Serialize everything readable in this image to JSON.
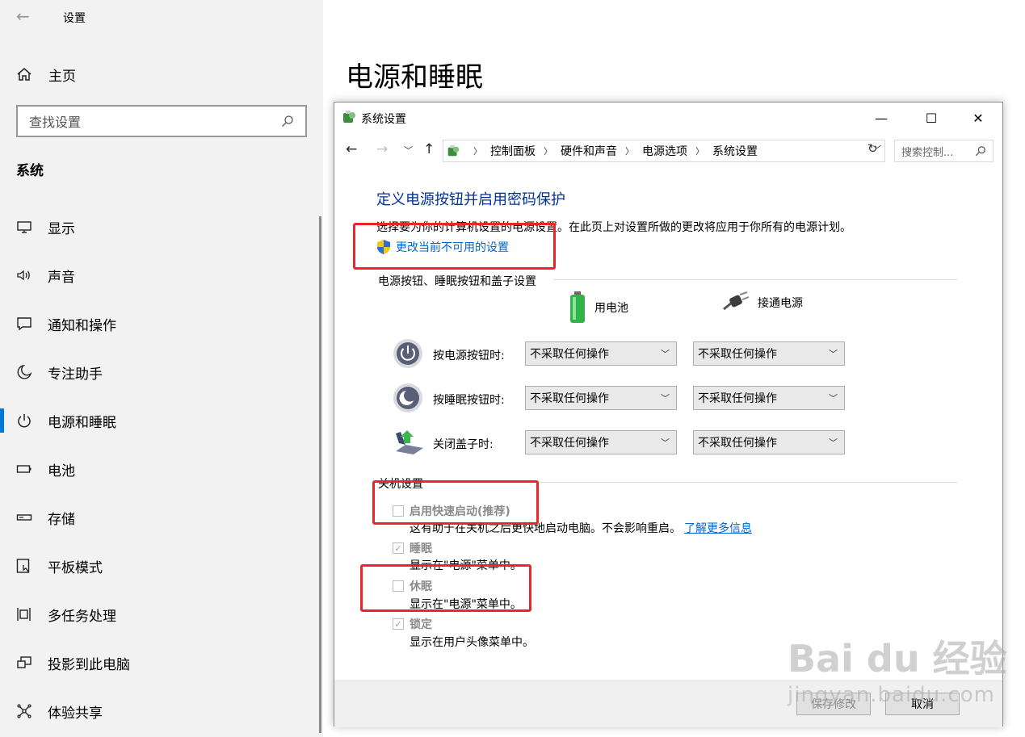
{
  "settings": {
    "app_title": "设置",
    "home_label": "主页",
    "search_placeholder": "查找设置",
    "section_title": "系统",
    "nav_items": [
      {
        "label": "显示",
        "icon": "monitor-icon"
      },
      {
        "label": "声音",
        "icon": "speaker-icon"
      },
      {
        "label": "通知和操作",
        "icon": "notification-icon"
      },
      {
        "label": "专注助手",
        "icon": "moon-icon"
      },
      {
        "label": "电源和睡眠",
        "icon": "power-icon",
        "active": true
      },
      {
        "label": "电池",
        "icon": "battery-icon"
      },
      {
        "label": "存储",
        "icon": "storage-icon"
      },
      {
        "label": "平板模式",
        "icon": "tablet-icon"
      },
      {
        "label": "多任务处理",
        "icon": "multitask-icon"
      },
      {
        "label": "投影到此电脑",
        "icon": "project-icon"
      },
      {
        "label": "体验共享",
        "icon": "share-icon"
      }
    ],
    "accent_color": "#0078d7"
  },
  "page": {
    "title": "电源和睡眠"
  },
  "dialog": {
    "title": "系统设置",
    "window_buttons": {
      "minimize": "—",
      "maximize": "☐",
      "close": "✕"
    },
    "breadcrumb": [
      "控制面板",
      "硬件和声音",
      "电源选项",
      "系统设置"
    ],
    "search_placeholder": "搜索控制...",
    "heading": "定义电源按钮并启用密码保护",
    "description": "选择要为你的计算机设置的电源设置。在此页上对设置所做的更改将应用于你所有的电源计划。",
    "change_link": "更改当前不可用的设置",
    "buttons_section": {
      "label": "电源按钮、睡眠按钮和盖子设置",
      "col_battery": "用电池",
      "col_plugged": "接通电源",
      "rows": [
        {
          "label": "按电源按钮时:",
          "battery": "不采取任何操作",
          "plugged": "不采取任何操作",
          "icon": "power-button-icon"
        },
        {
          "label": "按睡眠按钮时:",
          "battery": "不采取任何操作",
          "plugged": "不采取任何操作",
          "icon": "sleep-button-icon"
        },
        {
          "label": "关闭盖子时:",
          "battery": "不采取任何操作",
          "plugged": "不采取任何操作",
          "icon": "laptop-lid-icon"
        }
      ]
    },
    "shutdown_section": {
      "label": "关机设置",
      "options": [
        {
          "label": "启用快速启动(推荐)",
          "checked": false,
          "desc": "这有助于在关机之后更快地启动电脑。不会影响重启。",
          "link": "了解更多信息"
        },
        {
          "label": "睡眠",
          "checked": true,
          "desc": "显示在\"电源\"菜单中。"
        },
        {
          "label": "休眠",
          "checked": false,
          "desc": "显示在\"电源\"菜单中。"
        },
        {
          "label": "锁定",
          "checked": true,
          "desc": "显示在用户头像菜单中。"
        }
      ]
    },
    "footer": {
      "save": "保存修改",
      "cancel": "取消"
    }
  },
  "watermark": {
    "line1": "Bai du 经验",
    "line2": "jingyan.baidu.com"
  },
  "annotation_color": "#e8262b"
}
